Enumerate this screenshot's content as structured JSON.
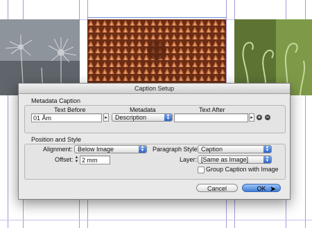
{
  "dialog": {
    "title": "Caption Setup",
    "metadata_caption": {
      "group_title": "Metadata Caption",
      "text_before_label": "Text Before",
      "metadata_label": "Metadata",
      "text_after_label": "Text After",
      "text_before_value": "01 Ãm",
      "metadata_value": "Description",
      "text_after_value": ""
    },
    "position_style": {
      "group_title": "Position and Style",
      "alignment_label": "Alignment:",
      "alignment_value": "Below Image",
      "offset_label": "Offset:",
      "offset_value": "2 mm",
      "paragraph_style_label": "Paragraph Style:",
      "paragraph_style_value": "Caption",
      "layer_label": "Layer:",
      "layer_value": "[Same as Image]",
      "group_caption_label": "Group Caption with Image",
      "group_caption_checked": false
    },
    "buttons": {
      "cancel": "Cancel",
      "ok": "OK"
    }
  },
  "icons": {
    "add": "plus-icon",
    "remove": "minus-icon",
    "insert": "triangle-right-icon",
    "dropdown": "updown-arrows-icon"
  },
  "colors": {
    "accent": "#3f7fd8",
    "guides": "#a79ad6"
  }
}
